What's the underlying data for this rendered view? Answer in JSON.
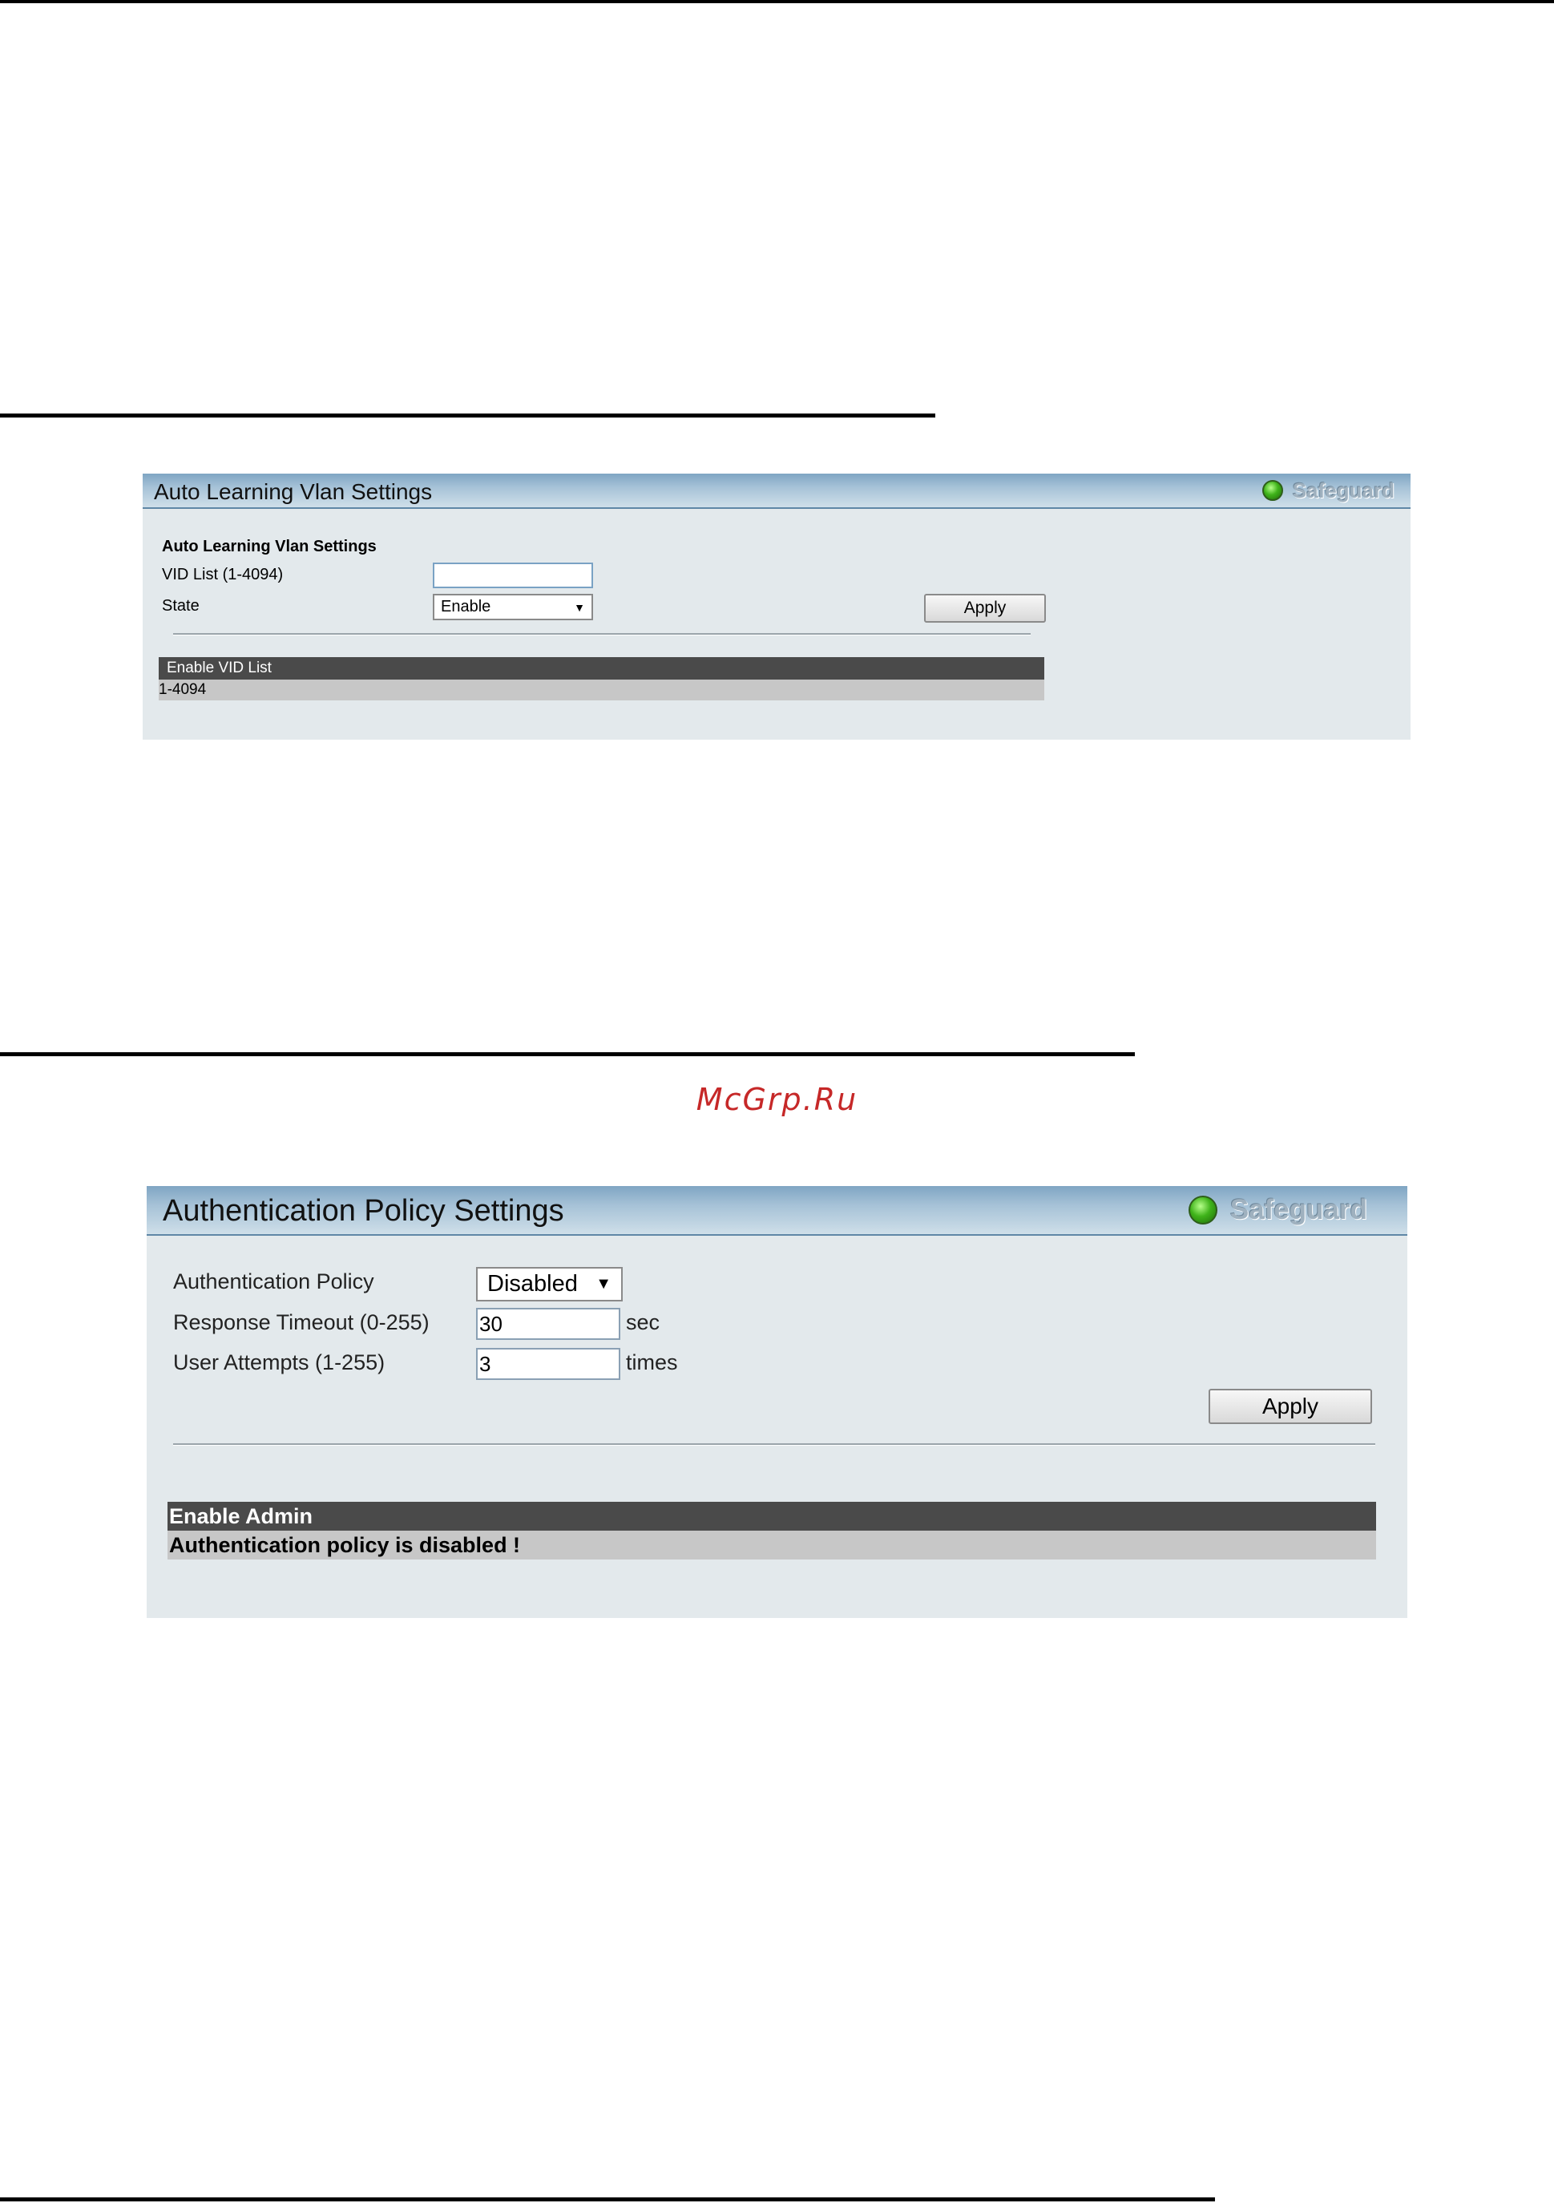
{
  "watermark": "McGrp.Ru",
  "vlan_panel": {
    "title": "Auto Learning Vlan Settings",
    "safeguard": "Safeguard",
    "section_title": "Auto Learning Vlan Settings",
    "vid_label": "VID List (1-4094)",
    "vid_value": "",
    "state_label": "State",
    "state_selected": "Enable",
    "apply_label": "Apply",
    "table_header": "Enable VID List",
    "table_rows": [
      "1-4094"
    ]
  },
  "auth_panel": {
    "title": "Authentication Policy Settings",
    "safeguard": "Safeguard",
    "policy_label": "Authentication Policy",
    "policy_selected": "Disabled",
    "timeout_label": "Response Timeout (0-255)",
    "timeout_value": "30",
    "timeout_unit": "sec",
    "attempts_label": "User Attempts (1-255)",
    "attempts_value": "3",
    "attempts_unit": "times",
    "apply_label": "Apply",
    "table_header": "Enable Admin",
    "table_message": "Authentication policy is disabled !"
  },
  "dropdown_arrow": "▼",
  "colors": {
    "header_gradient_top": "#7fa5c3",
    "panel_background": "#e3e9ec",
    "table_header": "#4a4a4a",
    "table_row": "#c7c7c7",
    "watermark": "#c62828",
    "safeguard_light": "#3fb31a"
  }
}
